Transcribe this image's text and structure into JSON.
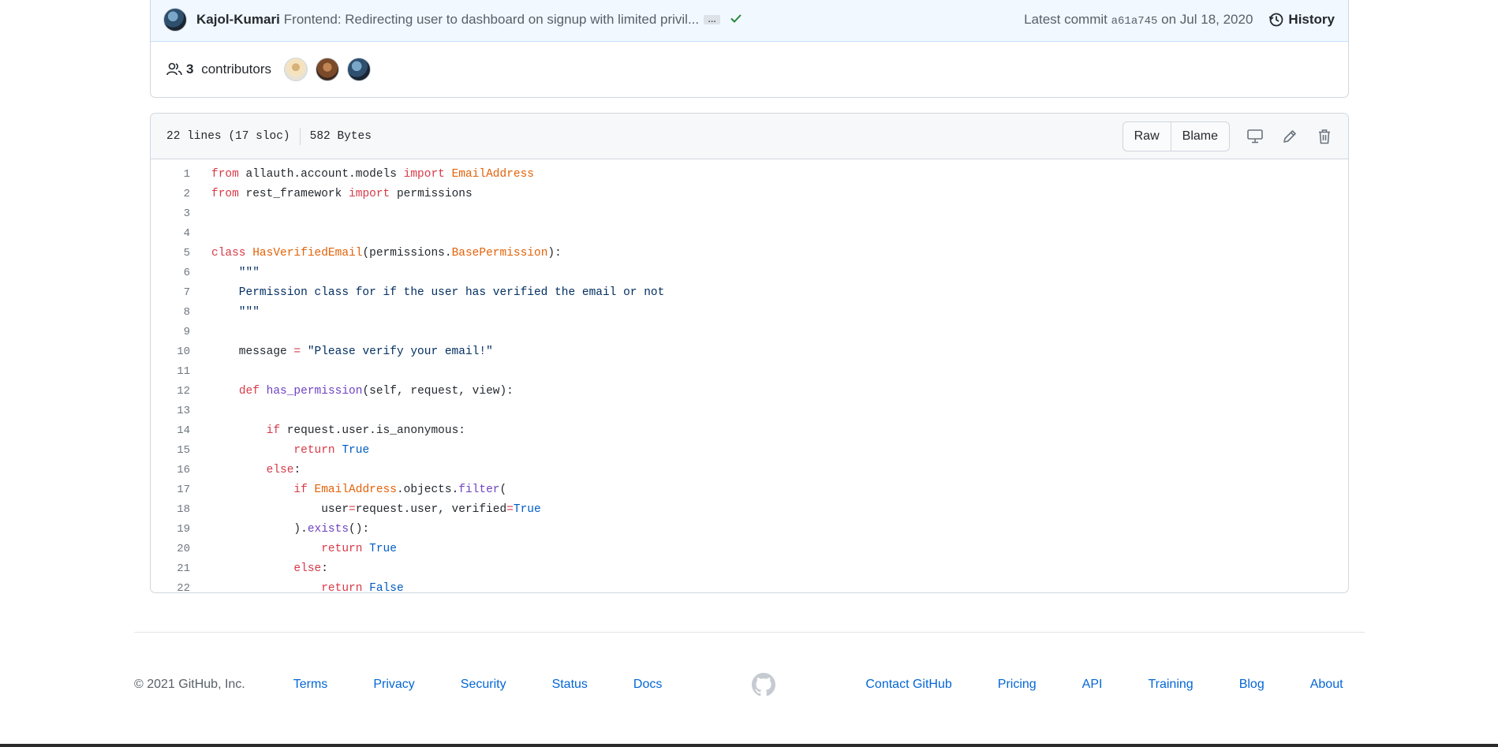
{
  "commit": {
    "author": "Kajol-Kumari",
    "message": "Frontend: Redirecting user to dashboard on signup with limited privil...",
    "ellipsis": "…",
    "latest_label": "Latest commit",
    "sha": "a61a745",
    "date": "on Jul 18, 2020",
    "history_label": "History"
  },
  "contributors": {
    "count": "3",
    "label": "contributors"
  },
  "file": {
    "lines_info": "22 lines (17 sloc)",
    "size": "582 Bytes",
    "raw_label": "Raw",
    "blame_label": "Blame"
  },
  "code_lines": [
    "1",
    "2",
    "3",
    "4",
    "5",
    "6",
    "7",
    "8",
    "9",
    "10",
    "11",
    "12",
    "13",
    "14",
    "15",
    "16",
    "17",
    "18",
    "19",
    "20",
    "21",
    "22"
  ],
  "code": {
    "l1_a": "from",
    "l1_b": " allauth.account.models ",
    "l1_c": "import",
    "l1_d": " ",
    "l1_e": "EmailAddress",
    "l2_a": "from",
    "l2_b": " rest_framework ",
    "l2_c": "import",
    "l2_d": " permissions",
    "l5_a": "class",
    "l5_b": " ",
    "l5_c": "HasVerifiedEmail",
    "l5_d": "(permissions.",
    "l5_e": "BasePermission",
    "l5_f": "):",
    "l6": "    \"\"\"",
    "l7": "    Permission class for if the user has verified the email or not",
    "l8": "    \"\"\"",
    "l10_a": "    message ",
    "l10_b": "=",
    "l10_c": " ",
    "l10_d": "\"Please verify your email!\"",
    "l12_a": "    ",
    "l12_b": "def",
    "l12_c": " ",
    "l12_d": "has_permission",
    "l12_e": "(self, request, view):",
    "l14_a": "        ",
    "l14_b": "if",
    "l14_c": " request.user.is_anonymous:",
    "l15_a": "            ",
    "l15_b": "return",
    "l15_c": " ",
    "l15_d": "True",
    "l16_a": "        ",
    "l16_b": "else",
    "l16_c": ":",
    "l17_a": "            ",
    "l17_b": "if",
    "l17_c": " ",
    "l17_d": "EmailAddress",
    "l17_e": ".objects.",
    "l17_f": "filter",
    "l17_g": "(",
    "l18_a": "                user",
    "l18_b": "=",
    "l18_c": "request.user, verified",
    "l18_d": "=",
    "l18_e": "True",
    "l19_a": "            ).",
    "l19_b": "exists",
    "l19_c": "():",
    "l20_a": "                ",
    "l20_b": "return",
    "l20_c": " ",
    "l20_d": "True",
    "l21_a": "            ",
    "l21_b": "else",
    "l21_c": ":",
    "l22_a": "                ",
    "l22_b": "return",
    "l22_c": " ",
    "l22_d": "False"
  },
  "footer": {
    "copyright": "© 2021 GitHub, Inc.",
    "left_links": [
      "Terms",
      "Privacy",
      "Security",
      "Status",
      "Docs"
    ],
    "right_links": [
      "Contact GitHub",
      "Pricing",
      "API",
      "Training",
      "Blog",
      "About"
    ]
  },
  "colors": {
    "keyword": "#d73a49",
    "class_name": "#e36209",
    "function": "#6f42c1",
    "constant": "#005cc5",
    "link": "#0366d6",
    "success": "#22863a"
  },
  "icons": [
    "history-icon",
    "people-icon",
    "check-icon",
    "desktop-icon",
    "pencil-icon",
    "trash-icon",
    "github-logo-icon"
  ]
}
